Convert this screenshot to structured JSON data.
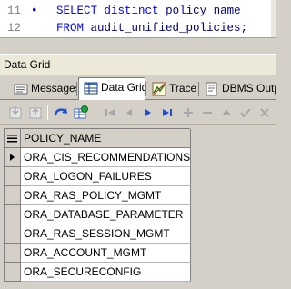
{
  "editor": {
    "lines": [
      {
        "number": "11",
        "marker": "•",
        "keyword1": "SELECT",
        "keyword2": "distinct",
        "identifier": "policy_name",
        "punct": ""
      },
      {
        "number": "12",
        "marker": "",
        "keyword1": "FROM",
        "keyword2": "",
        "identifier": "audit_unified_policies",
        "punct": ";"
      }
    ]
  },
  "panel": {
    "title": "Data Grid"
  },
  "tabs": [
    {
      "label": "Messages",
      "icon": "messages-icon",
      "active": false
    },
    {
      "label": "Data Grid",
      "icon": "data-grid-icon",
      "active": true
    },
    {
      "label": "Trace",
      "icon": "trace-icon",
      "active": false
    },
    {
      "label": "DBMS Output",
      "icon": "dbms-output-icon",
      "active": false
    }
  ],
  "grid": {
    "column_header": "POLICY_NAME",
    "rows": [
      "ORA_CIS_RECOMMENDATIONS",
      "ORA_LOGON_FAILURES",
      "ORA_RAS_POLICY_MGMT",
      "ORA_DATABASE_PARAMETER",
      "ORA_RAS_SESSION_MGMT",
      "ORA_ACCOUNT_MGMT",
      "ORA_SECURECONFIG"
    ],
    "current_row": 0
  },
  "colors": {
    "keyword": "#0000ff",
    "identifier": "#000080",
    "nav_blue": "#1f4fd6",
    "disabled": "#a8a8a8"
  }
}
